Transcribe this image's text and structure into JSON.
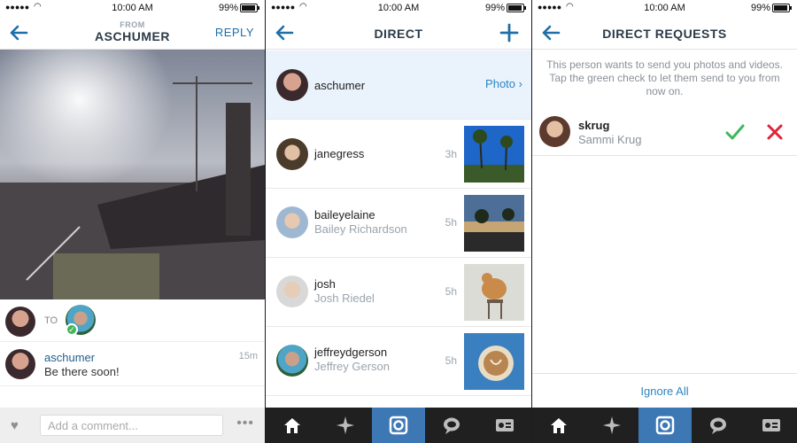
{
  "status": {
    "time": "10:00 AM",
    "battery": "99%"
  },
  "panel1": {
    "header_small": "FROM",
    "header_name": "ASCHUMER",
    "reply_label": "REPLY",
    "to_label": "TO",
    "comment": {
      "user": "aschumer",
      "text": "Be there soon!",
      "time": "15m"
    },
    "comment_placeholder": "Add a comment..."
  },
  "panel2": {
    "title": "DIRECT",
    "threads": [
      {
        "name": "aschumer",
        "sub": "",
        "time": "",
        "action": "Photo"
      },
      {
        "name": "janegress",
        "sub": "",
        "time": "3h"
      },
      {
        "name": "baileyelaine",
        "sub": "Bailey Richardson",
        "time": "5h"
      },
      {
        "name": "josh",
        "sub": "Josh Riedel",
        "time": "5h"
      },
      {
        "name": "jeffreydgerson",
        "sub": "Jeffrey Gerson",
        "time": "5h"
      }
    ]
  },
  "panel3": {
    "title": "DIRECT REQUESTS",
    "message": "This person wants to send you photos and videos. Tap the green check to let them send to you from now on.",
    "request": {
      "username": "skrug",
      "full_name": "Sammi Krug"
    },
    "ignore_label": "Ignore All"
  },
  "colors": {
    "accent": "#3d78b4",
    "link": "#2a85c4",
    "accept": "#3fb75a",
    "decline": "#e0243c",
    "tabbar": "#202020"
  },
  "icons": [
    "back-arrow-icon",
    "plus-icon",
    "chevron-right-icon",
    "heart-icon",
    "more-dots-icon",
    "home-icon",
    "explore-star-icon",
    "camera-icon",
    "activity-bubble-icon",
    "profile-card-icon",
    "check-icon",
    "x-icon"
  ]
}
